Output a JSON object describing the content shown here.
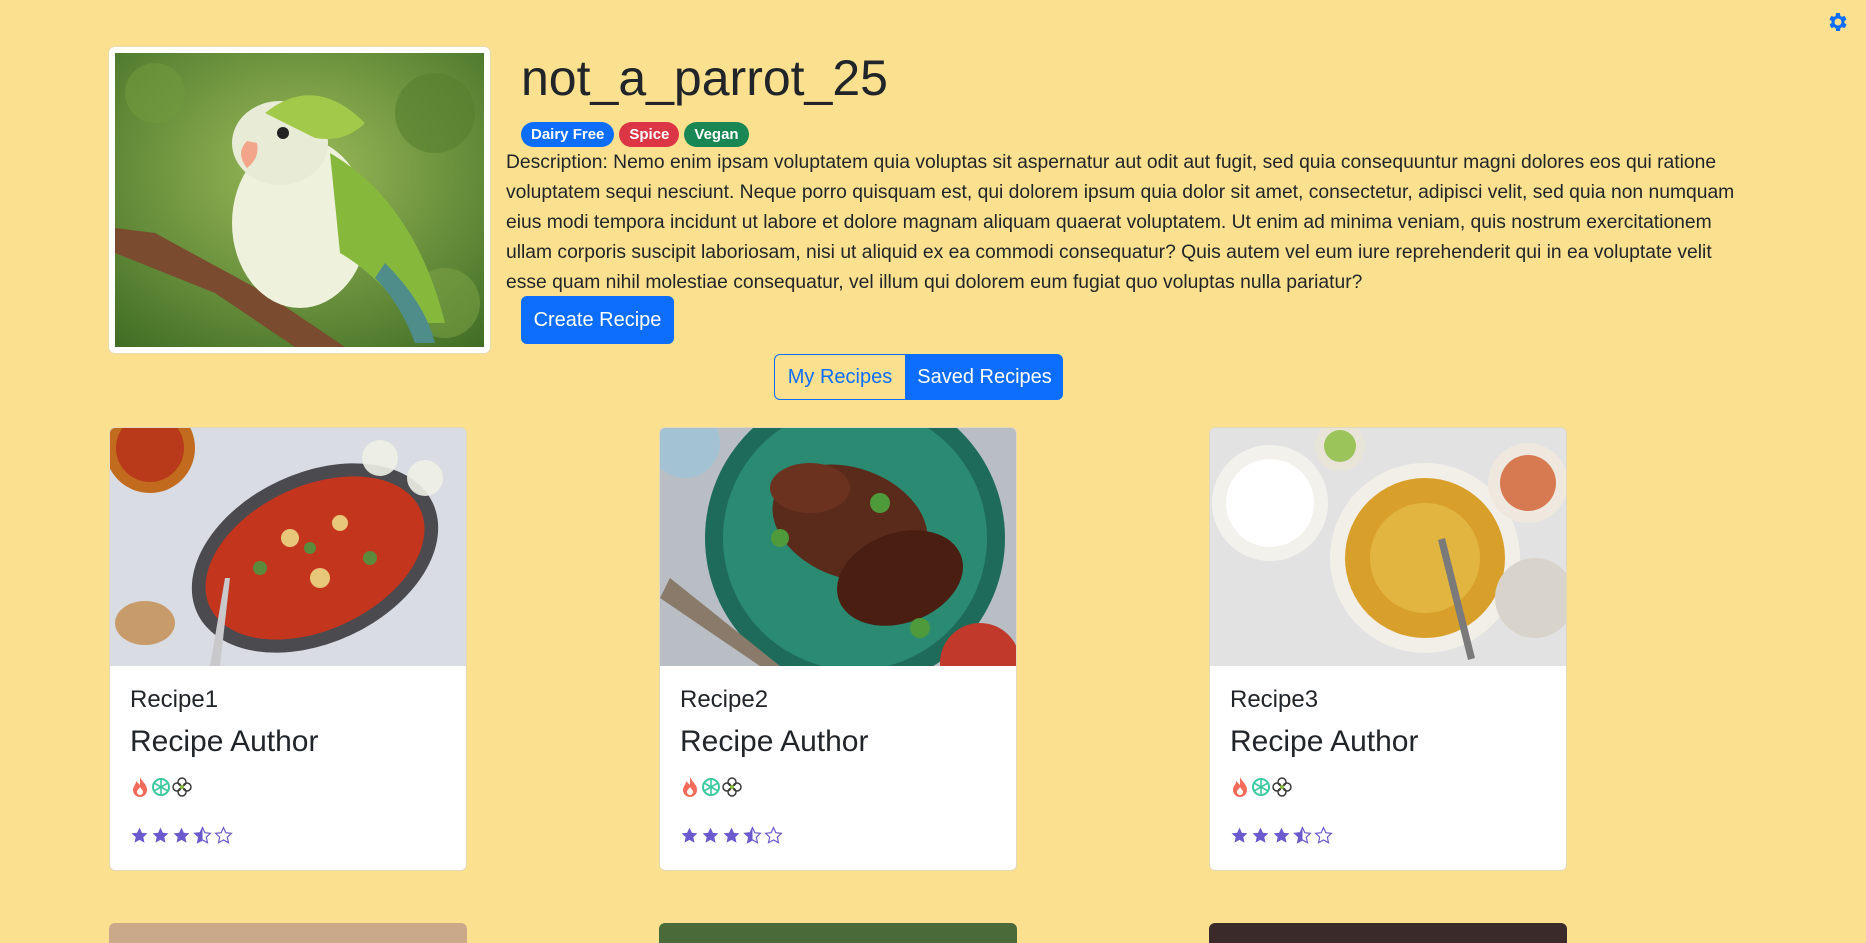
{
  "profile": {
    "username": "not_a_parrot_25",
    "badges": [
      {
        "label": "Dairy Free",
        "color": "#0d6efd"
      },
      {
        "label": "Spice",
        "color": "#dc3545"
      },
      {
        "label": "Vegan",
        "color": "#198754"
      }
    ],
    "description": "Description: Nemo enim ipsam voluptatem quia voluptas sit aspernatur aut odit aut fugit, sed quia consequuntur magni dolores eos qui ratione voluptatem sequi nesciunt. Neque porro quisquam est, qui dolorem ipsum quia dolor sit amet, consectetur, adipisci velit, sed quia non numquam eius modi tempora incidunt ut labore et dolore magnam aliquam quaerat voluptatem. Ut enim ad minima veniam, quis nostrum exercitationem ullam corporis suscipit laboriosam, nisi ut aliquid ex ea commodi consequatur? Quis autem vel eum iure reprehenderit qui in ea voluptate velit esse quam nihil molestiae consequatur, vel illum qui dolorem eum fugiat quo voluptas nulla pariatur?",
    "avatar_icon": "parrot-photo"
  },
  "actions": {
    "create_recipe": "Create Recipe"
  },
  "tabs": {
    "my_recipes": "My Recipes",
    "saved_recipes": "Saved Recipes",
    "active": "saved_recipes"
  },
  "settings_icon": "gear-icon",
  "theme": {
    "background": "#fbe18f",
    "primary": "#0d6efd",
    "star": "#6a5acd"
  },
  "recipes": [
    {
      "title": "Recipe1",
      "author": "Recipe Author",
      "diet_icons": [
        "fire-icon",
        "snowflake-icon",
        "clover-icon"
      ],
      "rating": 3.5,
      "rating_max": 5,
      "image": "lasagna-photo"
    },
    {
      "title": "Recipe2",
      "author": "Recipe Author",
      "diet_icons": [
        "fire-icon",
        "snowflake-icon",
        "clover-icon"
      ],
      "rating": 3.5,
      "rating_max": 5,
      "image": "grilled-chicken-photo"
    },
    {
      "title": "Recipe3",
      "author": "Recipe Author",
      "diet_icons": [
        "fire-icon",
        "snowflake-icon",
        "clover-icon"
      ],
      "rating": 3.5,
      "rating_max": 5,
      "image": "curry-pasta-photo"
    }
  ]
}
